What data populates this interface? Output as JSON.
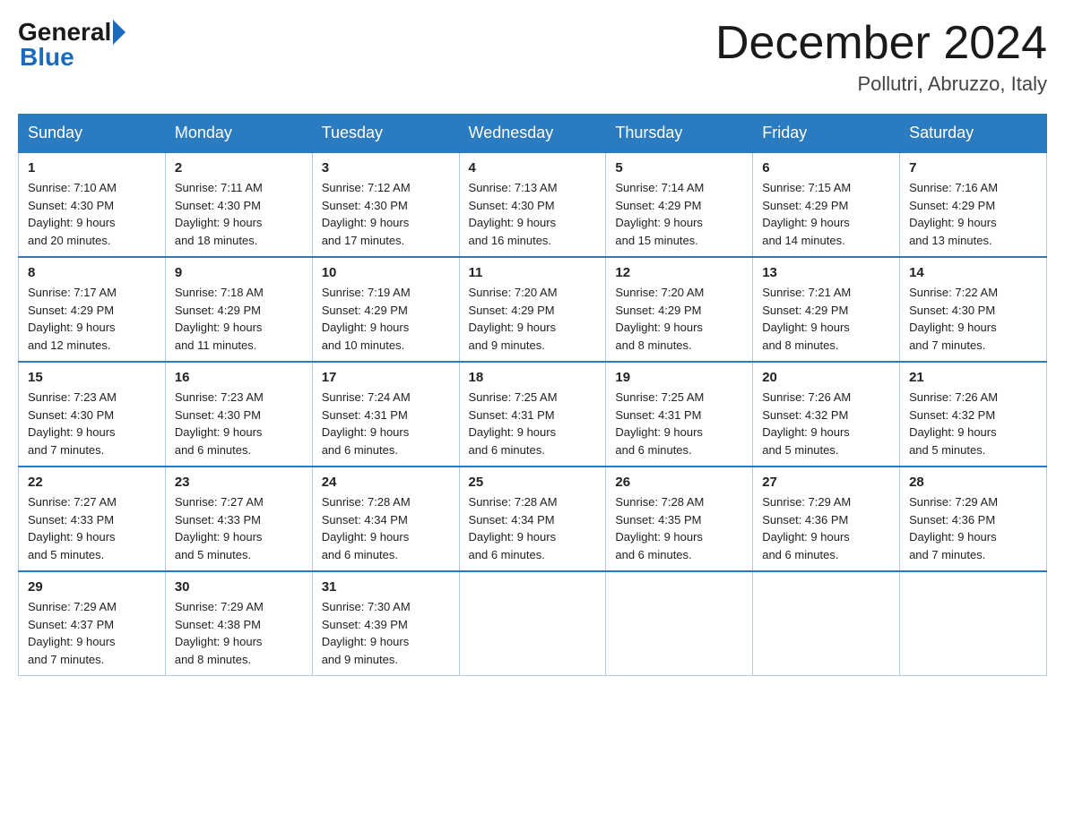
{
  "logo": {
    "general": "General",
    "blue": "Blue"
  },
  "title": "December 2024",
  "subtitle": "Pollutri, Abruzzo, Italy",
  "days_of_week": [
    "Sunday",
    "Monday",
    "Tuesday",
    "Wednesday",
    "Thursday",
    "Friday",
    "Saturday"
  ],
  "weeks": [
    [
      {
        "day": "1",
        "sunrise": "7:10 AM",
        "sunset": "4:30 PM",
        "daylight": "9 hours and 20 minutes."
      },
      {
        "day": "2",
        "sunrise": "7:11 AM",
        "sunset": "4:30 PM",
        "daylight": "9 hours and 18 minutes."
      },
      {
        "day": "3",
        "sunrise": "7:12 AM",
        "sunset": "4:30 PM",
        "daylight": "9 hours and 17 minutes."
      },
      {
        "day": "4",
        "sunrise": "7:13 AM",
        "sunset": "4:30 PM",
        "daylight": "9 hours and 16 minutes."
      },
      {
        "day": "5",
        "sunrise": "7:14 AM",
        "sunset": "4:29 PM",
        "daylight": "9 hours and 15 minutes."
      },
      {
        "day": "6",
        "sunrise": "7:15 AM",
        "sunset": "4:29 PM",
        "daylight": "9 hours and 14 minutes."
      },
      {
        "day": "7",
        "sunrise": "7:16 AM",
        "sunset": "4:29 PM",
        "daylight": "9 hours and 13 minutes."
      }
    ],
    [
      {
        "day": "8",
        "sunrise": "7:17 AM",
        "sunset": "4:29 PM",
        "daylight": "9 hours and 12 minutes."
      },
      {
        "day": "9",
        "sunrise": "7:18 AM",
        "sunset": "4:29 PM",
        "daylight": "9 hours and 11 minutes."
      },
      {
        "day": "10",
        "sunrise": "7:19 AM",
        "sunset": "4:29 PM",
        "daylight": "9 hours and 10 minutes."
      },
      {
        "day": "11",
        "sunrise": "7:20 AM",
        "sunset": "4:29 PM",
        "daylight": "9 hours and 9 minutes."
      },
      {
        "day": "12",
        "sunrise": "7:20 AM",
        "sunset": "4:29 PM",
        "daylight": "9 hours and 8 minutes."
      },
      {
        "day": "13",
        "sunrise": "7:21 AM",
        "sunset": "4:29 PM",
        "daylight": "9 hours and 8 minutes."
      },
      {
        "day": "14",
        "sunrise": "7:22 AM",
        "sunset": "4:30 PM",
        "daylight": "9 hours and 7 minutes."
      }
    ],
    [
      {
        "day": "15",
        "sunrise": "7:23 AM",
        "sunset": "4:30 PM",
        "daylight": "9 hours and 7 minutes."
      },
      {
        "day": "16",
        "sunrise": "7:23 AM",
        "sunset": "4:30 PM",
        "daylight": "9 hours and 6 minutes."
      },
      {
        "day": "17",
        "sunrise": "7:24 AM",
        "sunset": "4:31 PM",
        "daylight": "9 hours and 6 minutes."
      },
      {
        "day": "18",
        "sunrise": "7:25 AM",
        "sunset": "4:31 PM",
        "daylight": "9 hours and 6 minutes."
      },
      {
        "day": "19",
        "sunrise": "7:25 AM",
        "sunset": "4:31 PM",
        "daylight": "9 hours and 6 minutes."
      },
      {
        "day": "20",
        "sunrise": "7:26 AM",
        "sunset": "4:32 PM",
        "daylight": "9 hours and 5 minutes."
      },
      {
        "day": "21",
        "sunrise": "7:26 AM",
        "sunset": "4:32 PM",
        "daylight": "9 hours and 5 minutes."
      }
    ],
    [
      {
        "day": "22",
        "sunrise": "7:27 AM",
        "sunset": "4:33 PM",
        "daylight": "9 hours and 5 minutes."
      },
      {
        "day": "23",
        "sunrise": "7:27 AM",
        "sunset": "4:33 PM",
        "daylight": "9 hours and 5 minutes."
      },
      {
        "day": "24",
        "sunrise": "7:28 AM",
        "sunset": "4:34 PM",
        "daylight": "9 hours and 6 minutes."
      },
      {
        "day": "25",
        "sunrise": "7:28 AM",
        "sunset": "4:34 PM",
        "daylight": "9 hours and 6 minutes."
      },
      {
        "day": "26",
        "sunrise": "7:28 AM",
        "sunset": "4:35 PM",
        "daylight": "9 hours and 6 minutes."
      },
      {
        "day": "27",
        "sunrise": "7:29 AM",
        "sunset": "4:36 PM",
        "daylight": "9 hours and 6 minutes."
      },
      {
        "day": "28",
        "sunrise": "7:29 AM",
        "sunset": "4:36 PM",
        "daylight": "9 hours and 7 minutes."
      }
    ],
    [
      {
        "day": "29",
        "sunrise": "7:29 AM",
        "sunset": "4:37 PM",
        "daylight": "9 hours and 7 minutes."
      },
      {
        "day": "30",
        "sunrise": "7:29 AM",
        "sunset": "4:38 PM",
        "daylight": "9 hours and 8 minutes."
      },
      {
        "day": "31",
        "sunrise": "7:30 AM",
        "sunset": "4:39 PM",
        "daylight": "9 hours and 9 minutes."
      },
      null,
      null,
      null,
      null
    ]
  ]
}
